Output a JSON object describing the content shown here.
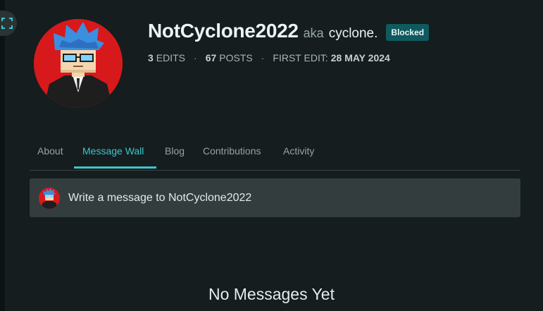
{
  "profile": {
    "username": "NotCyclone2022",
    "aka_label": "aka",
    "nickname": "cyclone.",
    "badge": "Blocked",
    "avatar_colors": {
      "background": "#d7191b",
      "hair": "#3b8fe0",
      "glasses": "#7fd3ff",
      "suit": "#222222"
    }
  },
  "stats": {
    "edits_count": "3",
    "edits_label": "EDITS",
    "posts_count": "67",
    "posts_label": "POSTS",
    "separator": "·",
    "first_edit_label": "FIRST EDIT:",
    "first_edit_date": "28 MAY 2024"
  },
  "tabs": [
    {
      "label": "About",
      "active": false
    },
    {
      "label": "Message Wall",
      "active": true
    },
    {
      "label": "Blog",
      "active": false
    },
    {
      "label": "Contributions",
      "active": false
    },
    {
      "label": "Activity",
      "active": false
    }
  ],
  "composer": {
    "placeholder": "Write a message to NotCyclone2022"
  },
  "empty_state": {
    "title": "No Messages Yet"
  },
  "theme": {
    "background": "#151d1e",
    "accent": "#3fc4cc",
    "badge_bg": "#0f5a5e",
    "composer_bg": "#333d3e"
  },
  "icons": {
    "fullscreen": "expand-corners-icon"
  }
}
